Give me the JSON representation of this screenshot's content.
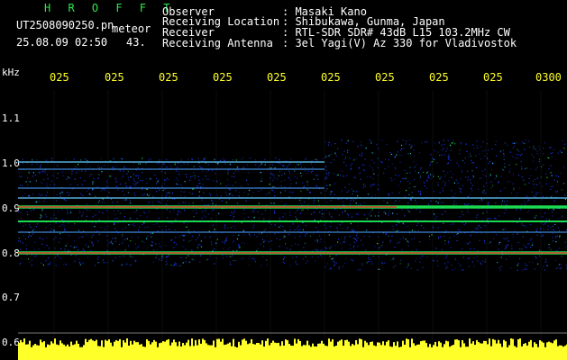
{
  "header": {
    "brand": "H R O F F T",
    "filename": "UT2508090250.pn",
    "tag": "meteor",
    "datetime": "25.08.09 02:50",
    "count": "43.",
    "fields": [
      {
        "label": "Observer",
        "value": ": Masaki Kano"
      },
      {
        "label": "Receiving Location",
        "value": ": Shibukawa, Gunma, Japan"
      },
      {
        "label": "Receiver",
        "value": ": RTL-SDR SDR# 43dB L15 103.2MHz CW"
      },
      {
        "label": "Receiving Antenna",
        "value": ": 3el Yagi(V) Az 330 for Vladivostok"
      }
    ]
  },
  "axis": {
    "unit": "kHz",
    "x_ticks": [
      "025",
      "025",
      "025",
      "025",
      "025",
      "025",
      "025",
      "025",
      "025",
      "0300"
    ],
    "y_ticks": [
      "1.1",
      "1.0",
      "0.9",
      "0.8",
      "0.7",
      "0.6"
    ]
  },
  "colors": {
    "background": "#000000",
    "brand": "#2ee84a",
    "header_text": "#ffffff",
    "accent": "#ffff2a",
    "band_core": "#ff2020",
    "band_mid": "#20ff60",
    "noise": "#1a3cff"
  }
}
